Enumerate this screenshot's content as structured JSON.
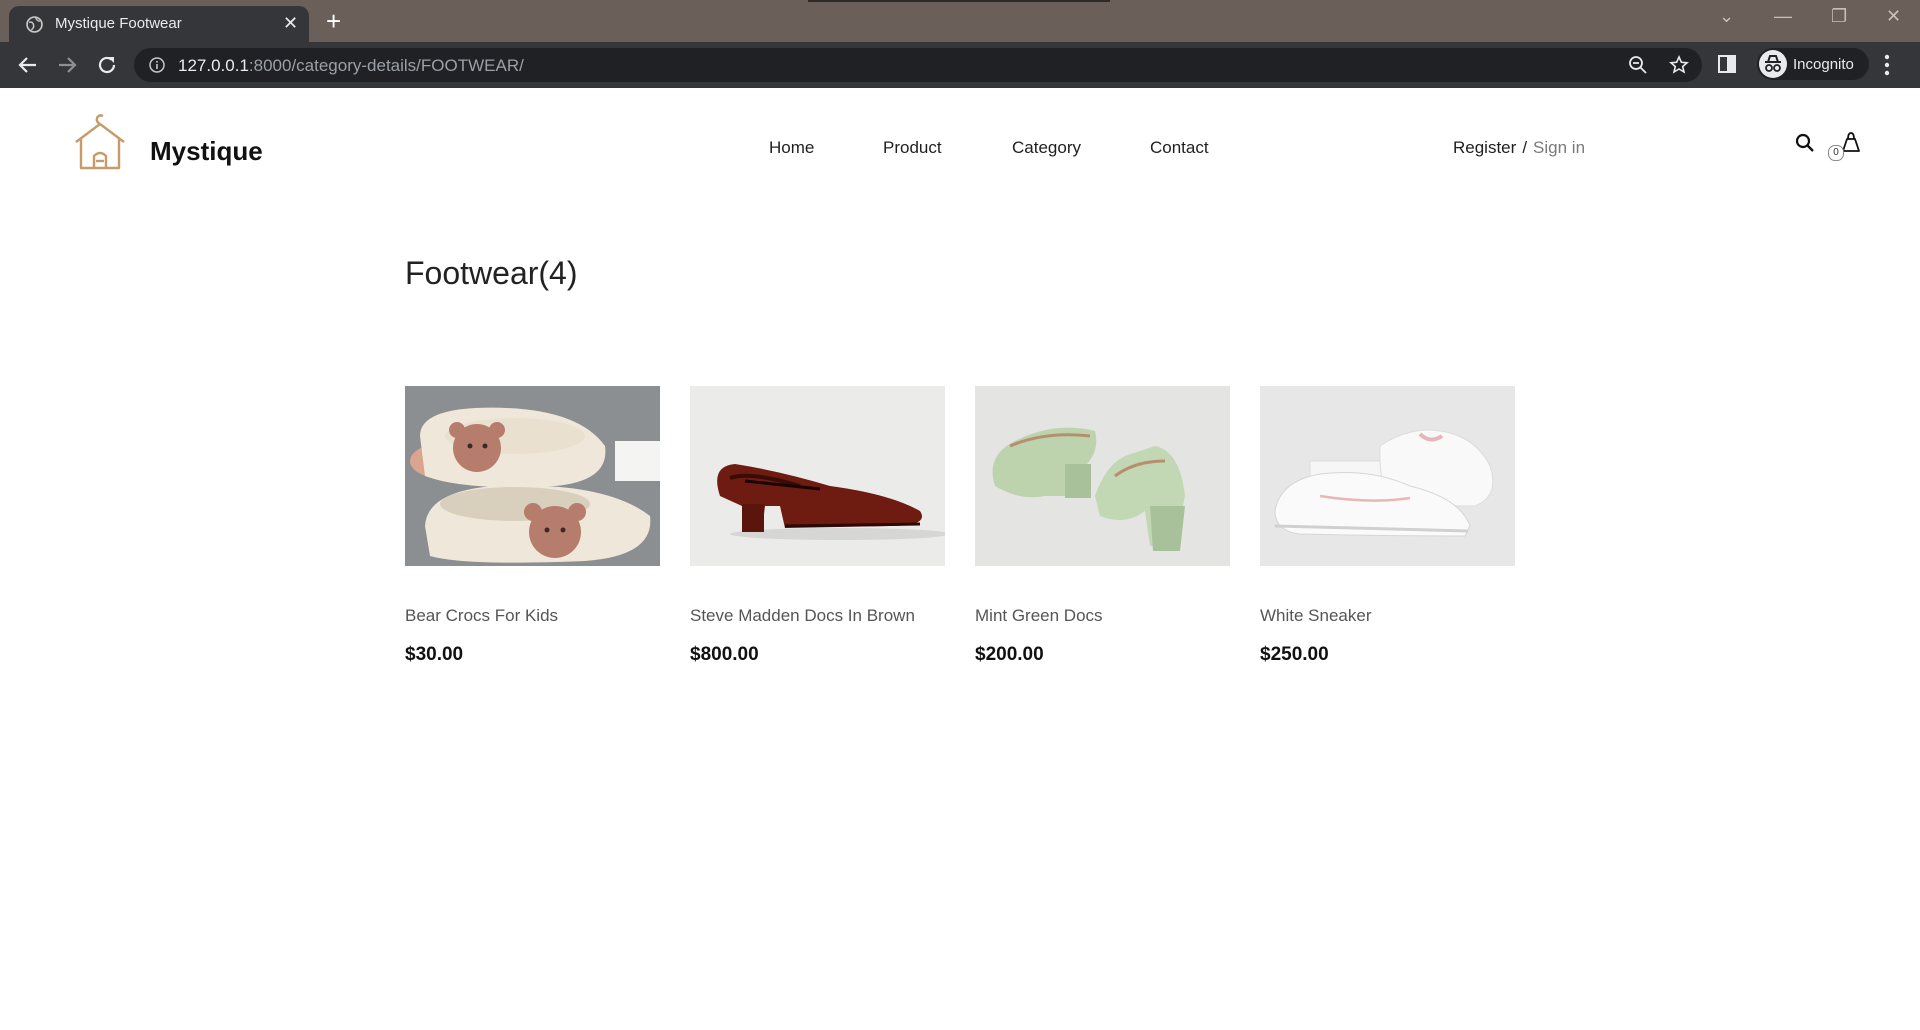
{
  "browser": {
    "tab_title": "Mystique Footwear",
    "url_host": "127.0.0.1",
    "url_rest": ":8000/category-details/FOOTWEAR/",
    "profile_label": "Incognito"
  },
  "site": {
    "brand": "Mystique",
    "nav": [
      "Home",
      "Product",
      "Category",
      "Contact"
    ],
    "register": "Register",
    "separator": "/",
    "signin": "Sign in",
    "cart_count": "0"
  },
  "main": {
    "title": "Footwear(4)",
    "products": [
      {
        "name": "Bear Crocs For Kids",
        "price": "$30.00"
      },
      {
        "name": "Steve Madden Docs In Brown",
        "price": "$800.00"
      },
      {
        "name": "Mint Green Docs",
        "price": "$200.00"
      },
      {
        "name": "White Sneaker",
        "price": "$250.00"
      }
    ]
  },
  "colors": {
    "tab_strip": "#6a5f59",
    "toolbar": "#35363a",
    "logo_accent": "#c79a6a"
  }
}
